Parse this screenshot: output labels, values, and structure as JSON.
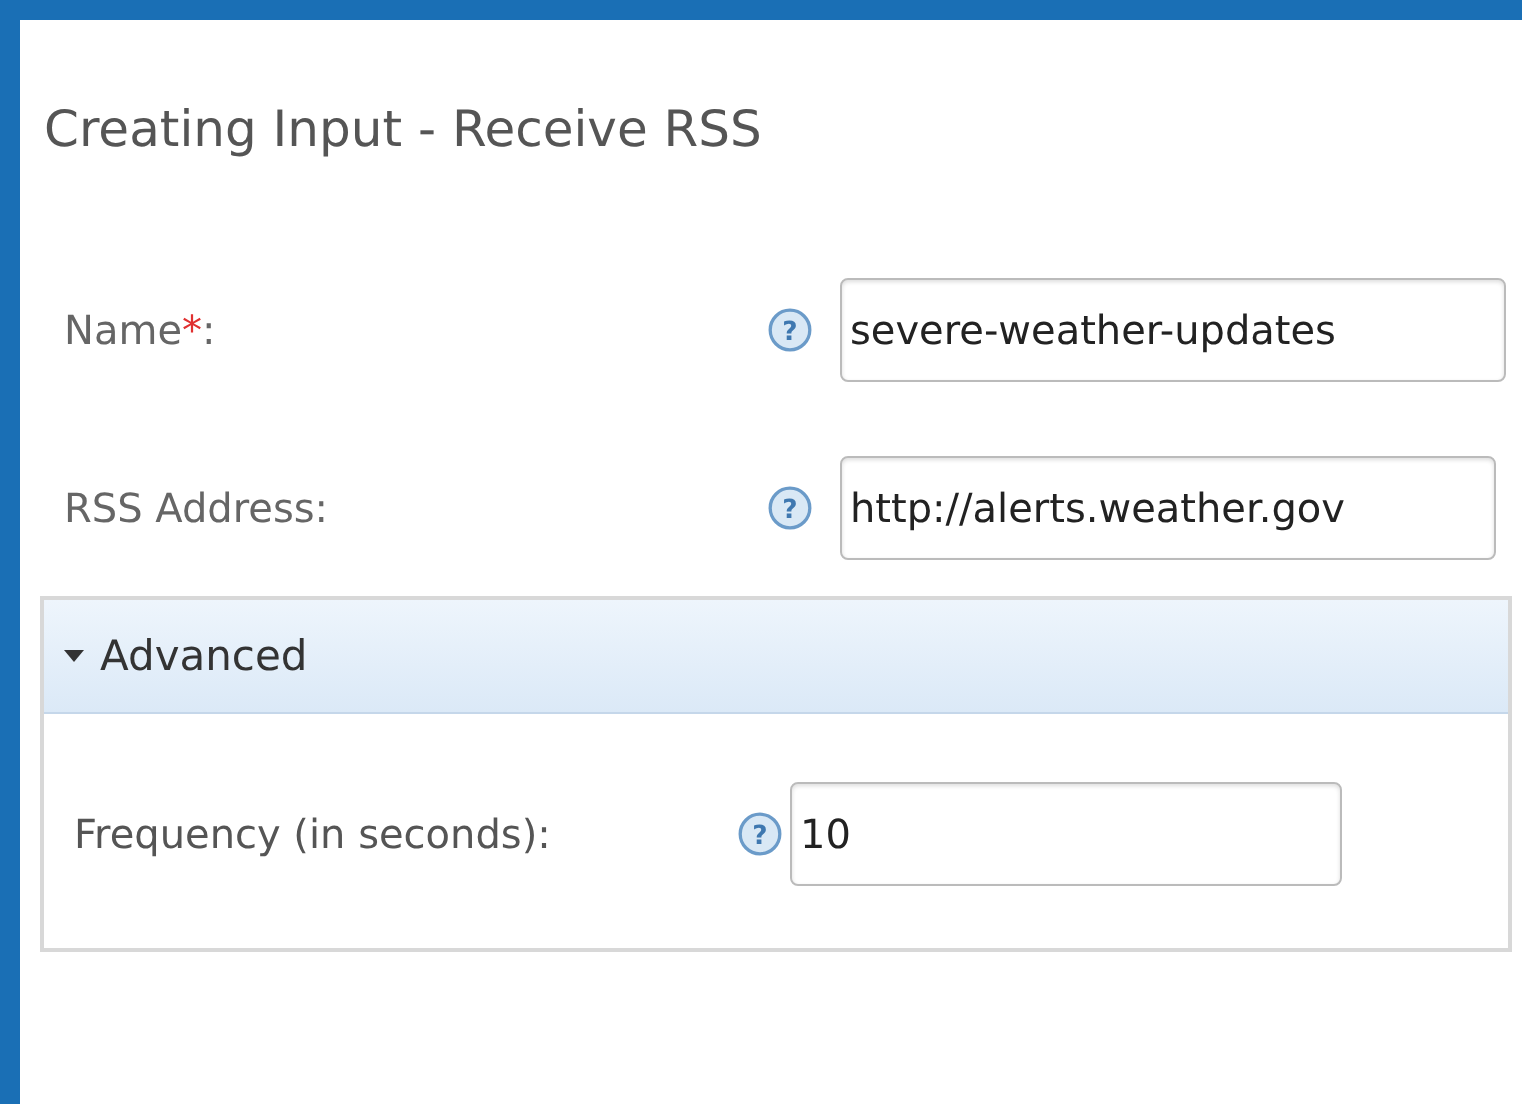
{
  "dialog": {
    "title": "Creating Input - Receive RSS"
  },
  "fields": [
    {
      "label": "Name",
      "required_mark": "*",
      "label_end": ":",
      "help": "?",
      "value": "severe-weather-updates"
    },
    {
      "label": "RSS Address:",
      "help": "?",
      "value": "http://alerts.weather.gov"
    }
  ],
  "advanced": {
    "title": "Advanced",
    "expanded": true,
    "fields": [
      {
        "label": "Frequency (in seconds):",
        "help": "?",
        "value": "10"
      }
    ]
  }
}
